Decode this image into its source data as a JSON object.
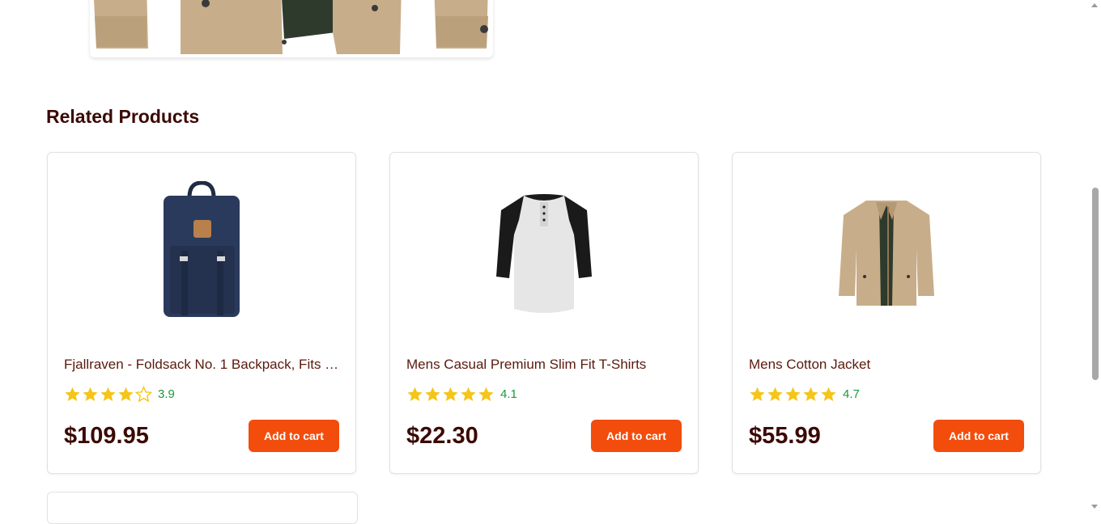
{
  "section_title": "Related Products",
  "colors": {
    "accent": "#f24d0c",
    "star": "#f5c518",
    "rating_text": "#1a9a3d",
    "title": "#3b0a05"
  },
  "products": [
    {
      "name": "Fjallraven - Foldsack No. 1 Backpack, Fits 1...",
      "rating": "3.9",
      "stars": 3.9,
      "price": "$109.95",
      "button": "Add to cart",
      "image_icon": "backpack-image"
    },
    {
      "name": "Mens Casual Premium Slim Fit T-Shirts",
      "rating": "4.1",
      "stars": 4.1,
      "price": "$22.30",
      "button": "Add to cart",
      "image_icon": "tshirt-image"
    },
    {
      "name": "Mens Cotton Jacket",
      "rating": "4.7",
      "stars": 4.7,
      "price": "$55.99",
      "button": "Add to cart",
      "image_icon": "jacket-image"
    }
  ]
}
